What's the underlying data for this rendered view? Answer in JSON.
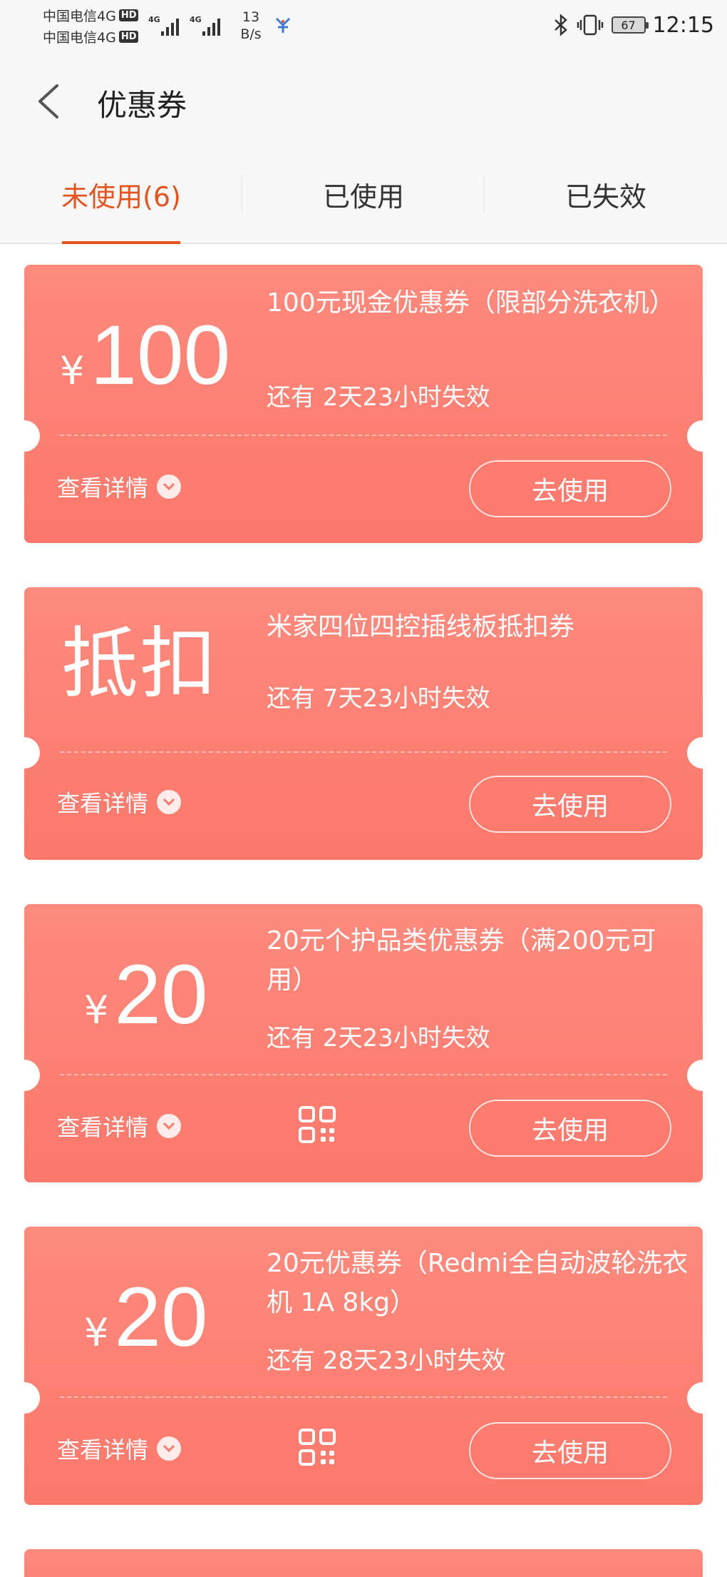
{
  "status_bar": {
    "carrier1": "中国电信4G",
    "carrier2": "中国电信4G",
    "hd1": "HD",
    "hd2": "HD",
    "net_type1": "4G",
    "net_type2": "4G",
    "net_speed_value": "13",
    "net_speed_unit": "B/s",
    "battery": "67",
    "time": "12:15"
  },
  "header": {
    "title": "优惠券"
  },
  "tabs": [
    {
      "label": "未使用(6)",
      "active": true
    },
    {
      "label": "已使用",
      "active": false
    },
    {
      "label": "已失效",
      "active": false
    }
  ],
  "coupons": [
    {
      "currency": "¥",
      "amount": "100",
      "name": "100元现金优惠券（限部分洗衣机）",
      "expiry": "还有 2天23小时失效",
      "details_label": "查看详情",
      "use_label": "去使用",
      "has_qr": false
    },
    {
      "big_text": "抵扣",
      "name": "米家四位四控插线板抵扣券",
      "expiry": "还有 7天23小时失效",
      "details_label": "查看详情",
      "use_label": "去使用",
      "has_qr": false
    },
    {
      "currency": "¥",
      "amount": "20",
      "name": "20元个护品类优惠券（满200元可用）",
      "expiry": "还有 2天23小时失效",
      "details_label": "查看详情",
      "use_label": "去使用",
      "has_qr": true
    },
    {
      "currency": "¥",
      "amount": "20",
      "name": "20元优惠券（Redmi全自动波轮洗衣机 1A 8kg）",
      "expiry": "还有 28天23小时失效",
      "details_label": "查看详情",
      "use_label": "去使用",
      "has_qr": true
    }
  ],
  "colors": {
    "accent": "#e5531e",
    "coupon_top": "#fd8a7d",
    "coupon_bottom": "#fb786b"
  }
}
